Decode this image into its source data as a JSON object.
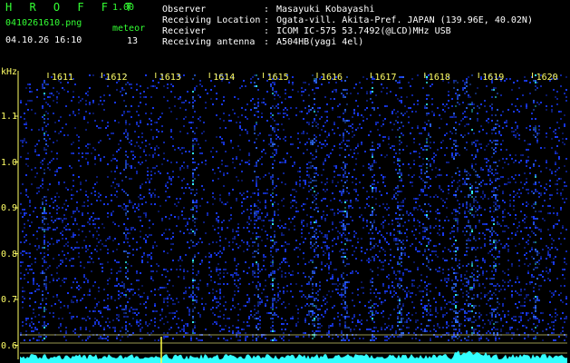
{
  "header": {
    "app_title": "H R O F F T",
    "app_version": "1.00",
    "file_name": "0410261610.png",
    "timestamp": "04.10.26 16:10",
    "meteor_label": "meteor",
    "meteor_count": "13"
  },
  "station_info": [
    {
      "key": "Observer",
      "value": "Masayuki Kobayashi"
    },
    {
      "key": "Receiving Location",
      "value": "Ogata-vill. Akita-Pref. JAPAN (139.96E, 40.02N)"
    },
    {
      "key": "Receiver",
      "value": "ICOM IC-575 53.7492(@LCD)MHz USB"
    },
    {
      "key": "Receiving antenna",
      "value": "A504HB(yagi 4el)"
    }
  ],
  "separator": ":",
  "axis": {
    "y_unit": "kHz",
    "y_ticks": [
      "1.1",
      "1.0",
      "0.9",
      "0.8",
      "0.7",
      "0.6"
    ],
    "y_tick_values": [
      1.1,
      1.0,
      0.9,
      0.8,
      0.7,
      0.6
    ],
    "x_ticks": [
      "1611",
      "1612",
      "1613",
      "1614",
      "1615",
      "1616",
      "1617",
      "1618",
      "1619",
      "1620"
    ],
    "y_range": [
      0.6,
      1.2
    ],
    "x_range": [
      "16:10",
      "16:20"
    ]
  },
  "colors": {
    "background": "#000000",
    "text_green": "#33ff33",
    "text_white": "#ffffff",
    "axis_yellow": "#ffff66",
    "noise_blue": "#1a3cff",
    "signal_cyan": "#33ffff",
    "bright_green": "#66ff66"
  }
}
